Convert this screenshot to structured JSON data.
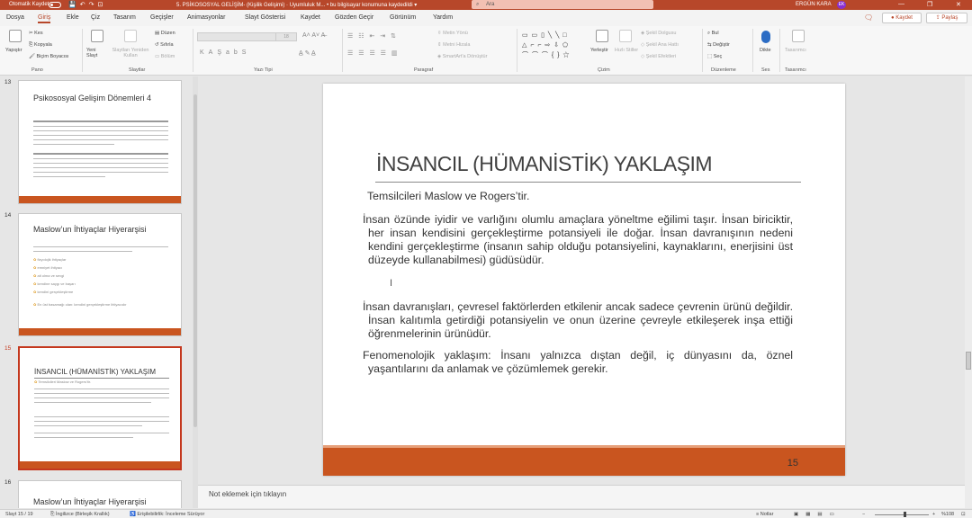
{
  "titlebar": {
    "autosave": "Otomatik Kaydet",
    "doc_title": "5. PSİKOSOSYAL GELİŞİM- (Kişilik Gelişimi) · Uyumluluk M... • bu bilgisayar konumuna kaydedildi ▾",
    "search": "Ara",
    "user": "ERGÜN KARA",
    "avatar": "EK",
    "window_minimize": "—",
    "window_restore": "❐",
    "window_close": "✕"
  },
  "menu": {
    "tabs": [
      "Dosya",
      "Giriş",
      "Ekle",
      "Çiz",
      "Tasarım",
      "Geçişler",
      "Animasyonlar",
      "Slayt Gösterisi",
      "Kaydet",
      "Gözden Geçir",
      "Görünüm",
      "Yardım"
    ],
    "active_tab": "Giriş",
    "save_button": "Kaydet",
    "share_button": "Paylaş"
  },
  "ribbon": {
    "paste": "Yapıştır",
    "cut": "Kes",
    "copy": "Kopyala",
    "format_painter": "Biçim Boyacısı",
    "new_slide": "Yeni Slayt",
    "reuse": "Slaytları Yeniden Kullan",
    "layout": "Düzen",
    "reset": "Sıfırla",
    "section": "Bölüm",
    "font_size": "18",
    "text_direction": "Metin Yönü",
    "align_text": "Metni Hizala",
    "smartart": "SmartArt'a Dönüştür",
    "arrange": "Yerleştir",
    "quick_styles": "Hızlı Stiller",
    "shape_fill": "Şekil Dolgusu",
    "shape_outline": "Şekil Ana Hattı",
    "shape_effects": "Şekil Efektleri",
    "find": "Bul",
    "replace": "Değiştir",
    "select": "Seç",
    "dictate": "Dikte",
    "designer": "Tasarımcı",
    "groups": {
      "clipboard": "Pano",
      "slides": "Slaytlar",
      "font": "Yazı Tipi",
      "paragraph": "Paragraf",
      "drawing": "Çizim",
      "editing": "Düzenleme",
      "voice": "Ses",
      "designer": "Tasarımcı"
    }
  },
  "thumbnails": [
    {
      "num": "13",
      "title": "Psikososyal Gelişim Dönemleri 4"
    },
    {
      "num": "14",
      "title": "Maslow’un İhtiyaçlar Hiyerarşisi",
      "bullets": [
        "fizyolojik ihtiyaçlar",
        "emniyet ihtiyacı",
        "ait olma ve sevgi",
        "kendine saygı ve başarı",
        "kendini gerçekleştirme"
      ],
      "footer": "En üst basamağı olan: kendini gerçekleştirme ihtiyacıdır"
    },
    {
      "num": "15",
      "title": "İNSANCIL (HÜMANİSTİK) YAKLAŞIM",
      "subtitle": "Temsilcileri Maslow ve Rogers’tir."
    },
    {
      "num": "16",
      "title": "Maslow’un İhtiyaçlar Hiyerarşisi"
    }
  ],
  "slide": {
    "title": "İNSANCIL (HÜMANİSTİK) YAKLAŞIM",
    "p1": "Temsilcileri Maslow ve Rogers’tir.",
    "p2": "İnsan özünde iyidir ve varlığını olumlu amaçlara yöneltme eğilimi taşır. İnsan biriciktir, her insan kendisini gerçekleştirme potansiyeli ile doğar. İnsan davranışının nedeni kendini gerçekleştirme (insanın sahip olduğu potansiyelini, kaynaklarını, enerjisini üst düzeyde kullanabilmesi) güdüsüdür.",
    "p3": "İnsan davranışları, çevresel faktörlerden etkilenir ancak sadece çevrenin ürünü değildir. İnsan kalıtımla getirdiği potansiyelin ve onun üzerine çevreyle etkileşerek inşa ettiği öğrenmelerinin ürünüdür.",
    "p4": "Fenomenolojik yaklaşım: İnsanı yalnızca dıştan değil, iç dünyasını da, öznel yaşantılarını da anlamak ve çözümlemek gerekir.",
    "cursor": "I",
    "number": "15"
  },
  "notes": {
    "placeholder": "Not eklemek için tıklayın"
  },
  "status": {
    "slide": "Slayt 15 / 19",
    "language": "İngilizce (Birleşik Krallık)",
    "accessibility": "Erişilebilirlik: İnceleme Sürüyor",
    "notes": "Notlar",
    "zoom": "%108"
  },
  "colors": {
    "accent": "#b7472a",
    "slide_bar": "#c9551f"
  }
}
